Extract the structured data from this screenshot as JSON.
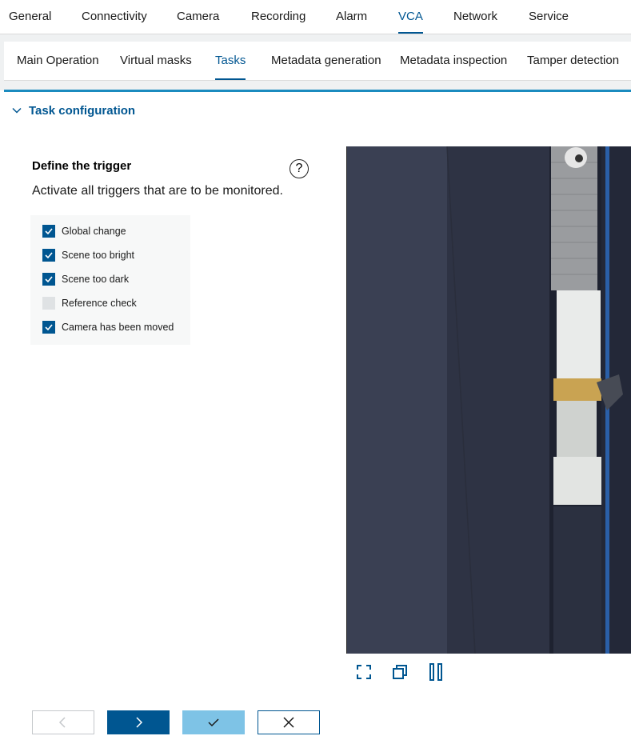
{
  "top_nav": {
    "tabs": [
      "General",
      "Connectivity",
      "Camera",
      "Recording",
      "Alarm",
      "VCA",
      "Network",
      "Service"
    ],
    "active": "VCA"
  },
  "sub_nav": {
    "tabs": [
      "Main Operation",
      "Virtual masks",
      "Tasks",
      "Metadata generation",
      "Metadata inspection",
      "Tamper detection"
    ],
    "active": "Tasks"
  },
  "section": {
    "title": "Task configuration"
  },
  "trigger": {
    "title": "Define the trigger",
    "description": "Activate all triggers that are to be monitored.",
    "help_icon": "question-icon",
    "options": [
      {
        "label": "Global change",
        "checked": true
      },
      {
        "label": "Scene too bright",
        "checked": true
      },
      {
        "label": "Scene too dark",
        "checked": true
      },
      {
        "label": "Reference check",
        "checked": false
      },
      {
        "label": "Camera has been moved",
        "checked": true
      }
    ]
  },
  "video_controls": [
    "fullscreen-icon",
    "popout-icon",
    "pause-icon"
  ],
  "buttons": {
    "prev": "chevron-left-icon",
    "next": "chevron-right-icon",
    "ok": "check-icon",
    "cancel": "close-icon"
  },
  "colors": {
    "accent": "#005691",
    "accent_light": "#7ec3e6",
    "bar": "#1b8bbf"
  }
}
